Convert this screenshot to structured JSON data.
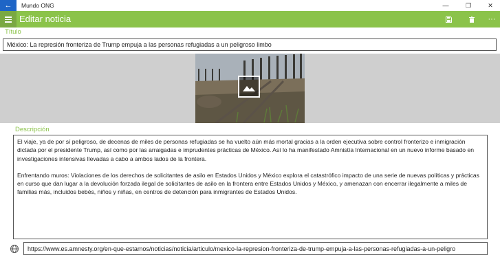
{
  "window": {
    "title": "Mundo ONG",
    "back_glyph": "←",
    "min_glyph": "—",
    "max_glyph": "❐",
    "close_glyph": "✕"
  },
  "appbar": {
    "title": "Editar noticia",
    "actions": [
      "save-icon",
      "delete-icon",
      "more-icon"
    ],
    "more_glyph": "···",
    "color": "#8bc34a"
  },
  "form": {
    "title_label": "Título",
    "title_value": "México: La represión fronteriza de Trump empuja a las personas refugiadas a un peligroso limbo",
    "description_label": "Descripción",
    "description_paragraphs": [
      "El viaje, ya de por sí peligroso, de decenas de miles de personas refugiadas se ha vuelto aún más mortal gracias a la orden ejecutiva sobre control fronterizo e inmigración dictada por el presidente Trump, así como por las arraigadas e imprudentes prácticas de México. Así lo ha manifestado Amnistía Internacional en un nuevo informe basado en investigaciones intensivas llevadas a cabo a ambos lados de la frontera.",
      "Enfrentando muros: Violaciones de los derechos de solicitantes de asilo en Estados Unidos y México explora el catastrófico impacto de una serie de nuevas políticas y prácticas en curso que dan lugar a la devolución forzada ilegal de solicitantes de asilo en la frontera entre Estados Unidos y México, y amenazan con encerrar ilegalmente a miles de familias más, incluidos bebés, niños y niñas, en centros de detención para inmigrantes de Estados Unidos."
    ],
    "url_value": "https://www.es.amnesty.org/en-que-estamos/noticias/noticia/articulo/mexico-la-represion-fronteriza-de-trump-empuja-a-las-personas-refugiadas-a-un-peligro"
  }
}
